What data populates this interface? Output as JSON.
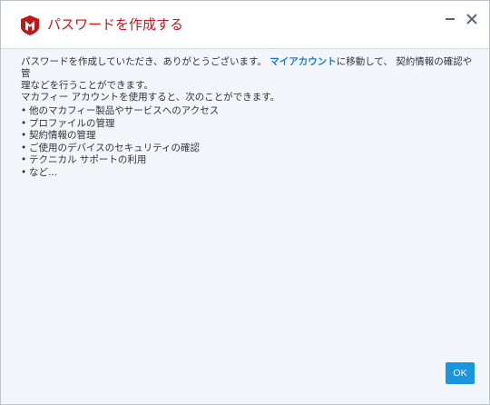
{
  "window": {
    "title": "パスワードを作成する",
    "brand_color": "#c01818",
    "accent_color": "#1a95e0",
    "icons": [
      "mcafee-shield-logo",
      "minimize-icon",
      "close-icon"
    ]
  },
  "body": {
    "para1_before_link": "パスワードを作成していただき、ありがとうございます。",
    "link_text": "マイアカウント",
    "para1_after_link_line1": "に移動して、 契約情報の確認や管",
    "para1_line2": "理などを行うことができます。",
    "para2": "マカフィー アカウントを使用すると、次のことができます。",
    "bullet_glyph": "•",
    "bullets": [
      "他のマカフィー製品やサービスへのアクセス",
      "プロファイルの管理",
      "契約情報の管理",
      "ご使用のデバイスのセキュリティの確認",
      "テクニカル サポートの利用",
      "など..."
    ]
  },
  "footer": {
    "ok_label": "OK"
  }
}
